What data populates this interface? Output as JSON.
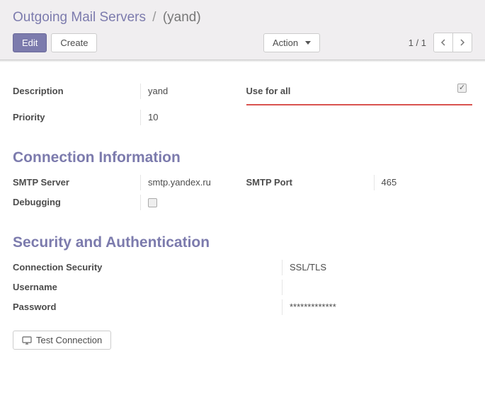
{
  "breadcrumb": {
    "parent": "Outgoing Mail Servers",
    "separator": "/",
    "current": "(yand)"
  },
  "toolbar": {
    "edit": "Edit",
    "create": "Create",
    "action": "Action"
  },
  "pager": {
    "text": "1 / 1"
  },
  "fields": {
    "description_label": "Description",
    "description_value": "yand",
    "priority_label": "Priority",
    "priority_value": "10",
    "use_for_all_label": "Use for all",
    "use_for_all_checked": true
  },
  "connection": {
    "section_title": "Connection Information",
    "smtp_server_label": "SMTP Server",
    "smtp_server_value": "smtp.yandex.ru",
    "smtp_port_label": "SMTP Port",
    "smtp_port_value": "465",
    "debugging_label": "Debugging",
    "debugging_checked": false
  },
  "security": {
    "section_title": "Security and Authentication",
    "connection_security_label": "Connection Security",
    "connection_security_value": "SSL/TLS",
    "username_label": "Username",
    "username_value": "",
    "password_label": "Password",
    "password_value": "*************",
    "test_connection": "Test Connection"
  }
}
